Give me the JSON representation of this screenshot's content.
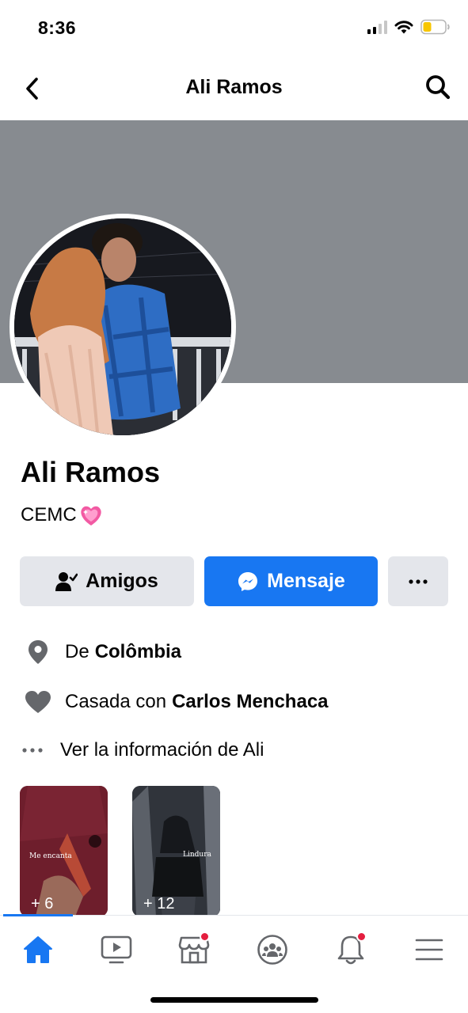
{
  "status_bar": {
    "time": "8:36"
  },
  "header": {
    "title": "Ali Ramos"
  },
  "profile": {
    "name": "Ali Ramos",
    "bio": "CEMC"
  },
  "actions": {
    "friends_label": "Amigos",
    "message_label": "Mensaje"
  },
  "info": {
    "from_prefix": "De",
    "from_value": "Colômbia",
    "relationship_prefix": "Casada con",
    "relationship_value": "Carlos Menchaca",
    "see_info": "Ver la información de Ali"
  },
  "photos": [
    {
      "count": "+ 6",
      "caption": "Me encanta"
    },
    {
      "count": "+ 12",
      "caption": "Lindura"
    }
  ],
  "tabs": [
    {
      "name": "home",
      "active": true
    },
    {
      "name": "watch"
    },
    {
      "name": "marketplace",
      "badge": true
    },
    {
      "name": "groups"
    },
    {
      "name": "notifications",
      "badge": true
    },
    {
      "name": "menu"
    }
  ],
  "colors": {
    "accent": "#1877f2",
    "button_gray": "#e4e6eb",
    "cover": "#878b90",
    "badge": "#e41e3f"
  }
}
